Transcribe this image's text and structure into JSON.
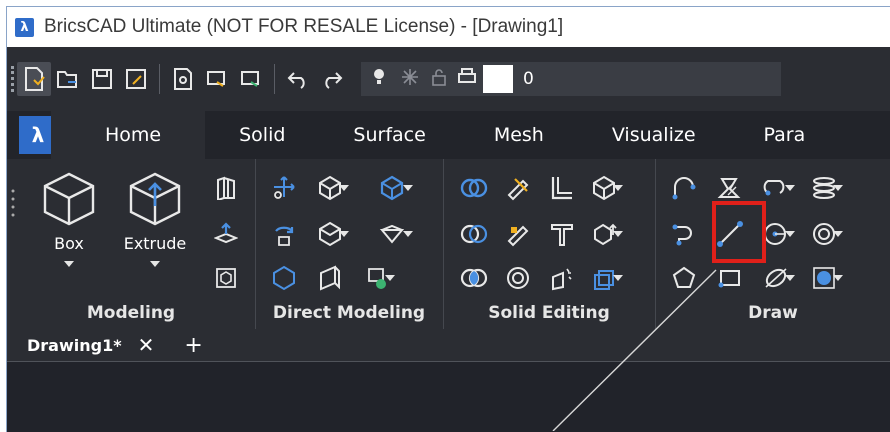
{
  "window": {
    "title": "BricsCAD Ultimate (NOT FOR RESALE License) - [Drawing1]",
    "logo_glyph": "λ"
  },
  "quick_access": {
    "layer_name": "0"
  },
  "ribbon_tabs": [
    {
      "label": "Home"
    },
    {
      "label": "Solid"
    },
    {
      "label": "Surface"
    },
    {
      "label": "Mesh"
    },
    {
      "label": "Visualize"
    },
    {
      "label": "Para"
    }
  ],
  "panels": {
    "modeling": {
      "title": "Modeling",
      "box_label": "Box",
      "extrude_label": "Extrude"
    },
    "direct_modeling": {
      "title": "Direct Modeling"
    },
    "solid_editing": {
      "title": "Solid Editing"
    },
    "draw": {
      "title": "Draw",
      "highlighted_tool": "line"
    }
  },
  "document_tabs": [
    {
      "label": "Drawing1*",
      "close": "✕"
    }
  ],
  "add_tab": "+",
  "colors": {
    "accent": "#2f6cc9",
    "highlight": "#e0201a",
    "icon_blue": "#4a90e2",
    "background": "#2b2d33"
  }
}
